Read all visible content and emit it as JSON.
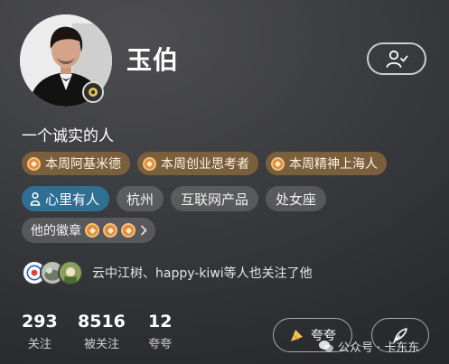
{
  "profile": {
    "name": "玉伯",
    "bio": "一个诚实的人"
  },
  "medals": [
    {
      "label": "本周阿基米德"
    },
    {
      "label": "本周创业思考者"
    },
    {
      "label": "本周精神上海人"
    }
  ],
  "tags": [
    {
      "label": "心里有人",
      "icon": "person-icon"
    },
    {
      "label": "杭州"
    },
    {
      "label": "互联网产品"
    },
    {
      "label": "处女座"
    }
  ],
  "badges": {
    "label": "他的徽章",
    "count": 3
  },
  "mutual": {
    "text": "云中江树、happy-kiwi等人也关注了他"
  },
  "stats": {
    "following": {
      "value": "293",
      "label": "关注"
    },
    "followers": {
      "value": "8516",
      "label": "被关注"
    },
    "praised": {
      "value": "12",
      "label": "夸夸"
    }
  },
  "actions": {
    "praise_label": "夸夸"
  },
  "watermark": "公众号 · 卡东东",
  "colors": {
    "medal_bg": "#7a5f3c",
    "medal_icon": "#e28a3a",
    "accent_tag": "#2e6f93",
    "tag_bg": "rgba(255,255,255,0.16)"
  }
}
